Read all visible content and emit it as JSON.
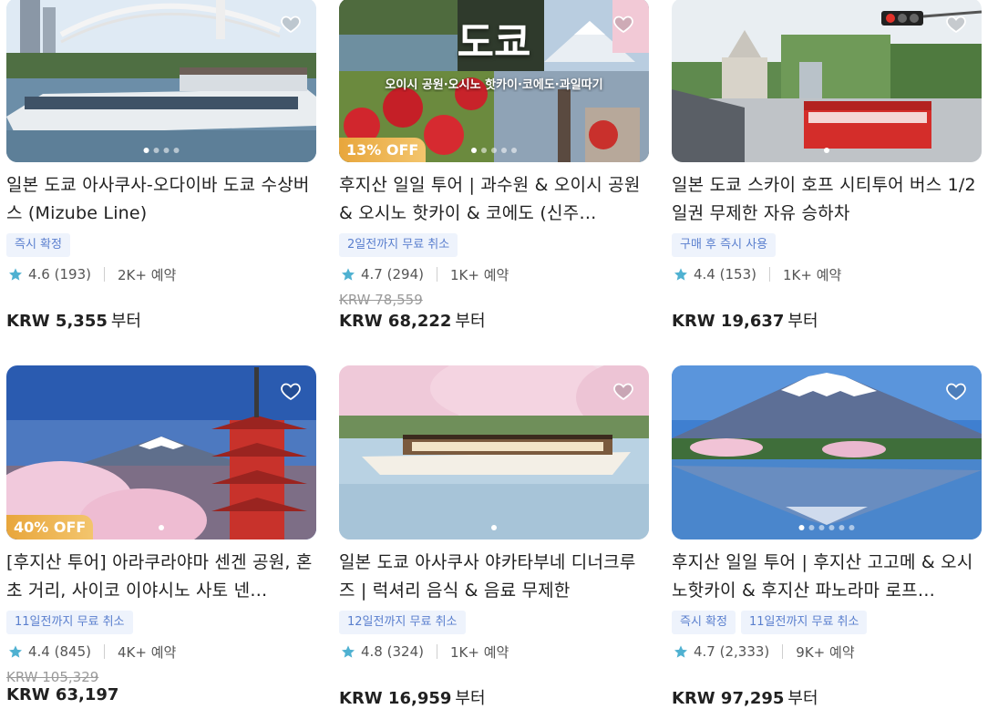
{
  "colors": {
    "accent_tag_bg": "#eef3fc",
    "accent_tag_text": "#5a7fce",
    "star": "#4fb1d1",
    "discount_badge": "#e8a63c"
  },
  "cards": [
    {
      "title": "일본 도쿄 아사쿠사-오다이바 도쿄 수상버스 (Mizube Line)",
      "tags": [
        "즉시 확정"
      ],
      "rating": "4.6",
      "reviews": "(193)",
      "bookings": "2K+ 예약",
      "original_price": "",
      "price": "KRW 5,355",
      "price_suffix": "부터",
      "discount": "",
      "image_icon": "river-boat-photo"
    },
    {
      "title": "후지산 일일 투어 | 과수원 & 오이시 공원 & 오시노 핫카이 & 코에도 (신주…",
      "tags": [
        "2일전까지 무료 취소"
      ],
      "rating": "4.7",
      "reviews": "(294)",
      "bookings": "1K+ 예약",
      "original_price": "KRW 78,559",
      "price": "KRW 68,222",
      "price_suffix": "부터",
      "discount": "13% OFF",
      "image_overlay_title": "도쿄",
      "image_overlay_sub": "오이시 공원·오시노 핫카이·코에도·과일따기",
      "image_icon": "strawberry-collage-photo"
    },
    {
      "title": "일본 도쿄 스카이 호프 시티투어 버스 1/2일권 무제한 자유 승하차",
      "tags": [
        "구매 후 즉시 사용"
      ],
      "rating": "4.4",
      "reviews": "(153)",
      "bookings": "1K+ 예약",
      "original_price": "",
      "price": "KRW 19,637",
      "price_suffix": "부터",
      "discount": "",
      "image_icon": "city-bus-photo"
    },
    {
      "title": "[후지산 투어] 아라쿠라야마 센겐 공원, 혼초 거리, 사이코 이야시노 사토 넨…",
      "tags": [
        "11일전까지 무료 취소"
      ],
      "rating": "4.4",
      "reviews": "(845)",
      "bookings": "4K+ 예약",
      "original_price": "KRW 105,329",
      "price": "KRW 63,197",
      "price_suffix": "",
      "discount": "40% OFF",
      "image_icon": "pagoda-fuji-photo"
    },
    {
      "title": "일본 도쿄 아사쿠사 야카타부네 디너크루즈 | 럭셔리 음식 & 음료 무제한",
      "tags": [
        "12일전까지 무료 취소"
      ],
      "rating": "4.8",
      "reviews": "(324)",
      "bookings": "1K+ 예약",
      "original_price": "",
      "price": "KRW 16,959",
      "price_suffix": "부터",
      "discount": "",
      "image_icon": "yakatabune-boat-photo"
    },
    {
      "title": "후지산 일일 투어 | 후지산 고고메 & 오시노핫카이 & 후지산 파노라마 로프…",
      "tags": [
        "즉시 확정",
        "11일전까지 무료 취소"
      ],
      "rating": "4.7",
      "reviews": "(2,333)",
      "bookings": "9K+ 예약",
      "original_price": "",
      "price": "KRW 97,295",
      "price_suffix": "부터",
      "discount": "",
      "image_icon": "fuji-lake-photo"
    }
  ]
}
